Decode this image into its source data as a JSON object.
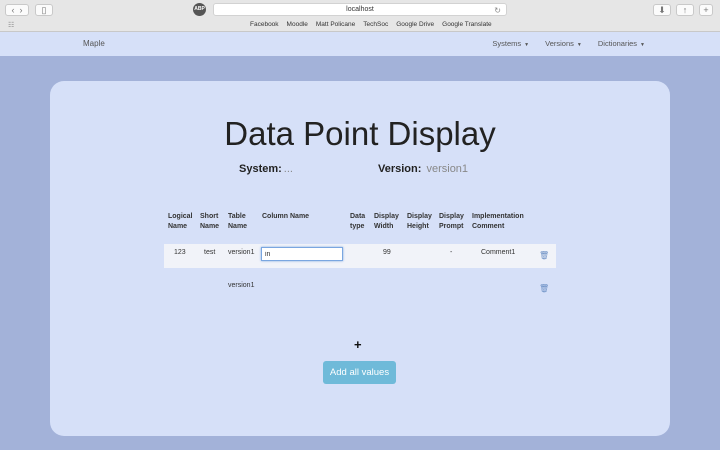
{
  "browser": {
    "url": "localhost",
    "bookmarks": [
      "Facebook",
      "Moodle",
      "Matt Policane",
      "TechSoc",
      "Google Drive",
      "Google Translate"
    ]
  },
  "nav": {
    "brand": "Maple",
    "menus": [
      "Systems",
      "Versions",
      "Dictionaries"
    ]
  },
  "page": {
    "title": "Data Point Display",
    "system_label": "System:",
    "system_value": "...",
    "version_label": "Version:",
    "version_value": "version1"
  },
  "table": {
    "headers": {
      "logical_name": [
        "Logical",
        "Name"
      ],
      "short_name": [
        "Short",
        "Name"
      ],
      "table_name": [
        "Table",
        "Name"
      ],
      "column_name": [
        "Column Name"
      ],
      "data_type": [
        "Data",
        "type"
      ],
      "display_width": [
        "Display",
        "Width"
      ],
      "display_height": [
        "Display",
        "Height"
      ],
      "display_prompt": [
        "Display",
        "Prompt"
      ],
      "implementation_comment": [
        "Implementation",
        "Comment"
      ]
    },
    "rows": [
      {
        "logical_name": "123",
        "short_name": "test",
        "table_name": "version1",
        "column_name_input": "in",
        "data_type": "",
        "display_width": "99",
        "display_height": "",
        "display_prompt": "-",
        "implementation_comment": "Comment1"
      },
      {
        "logical_name": "",
        "short_name": "",
        "table_name": "version1",
        "column_name_input": "",
        "data_type": "",
        "display_width": "",
        "display_height": "",
        "display_prompt": "",
        "implementation_comment": ""
      }
    ]
  },
  "actions": {
    "add_row": "+",
    "add_all": "Add all values"
  }
}
